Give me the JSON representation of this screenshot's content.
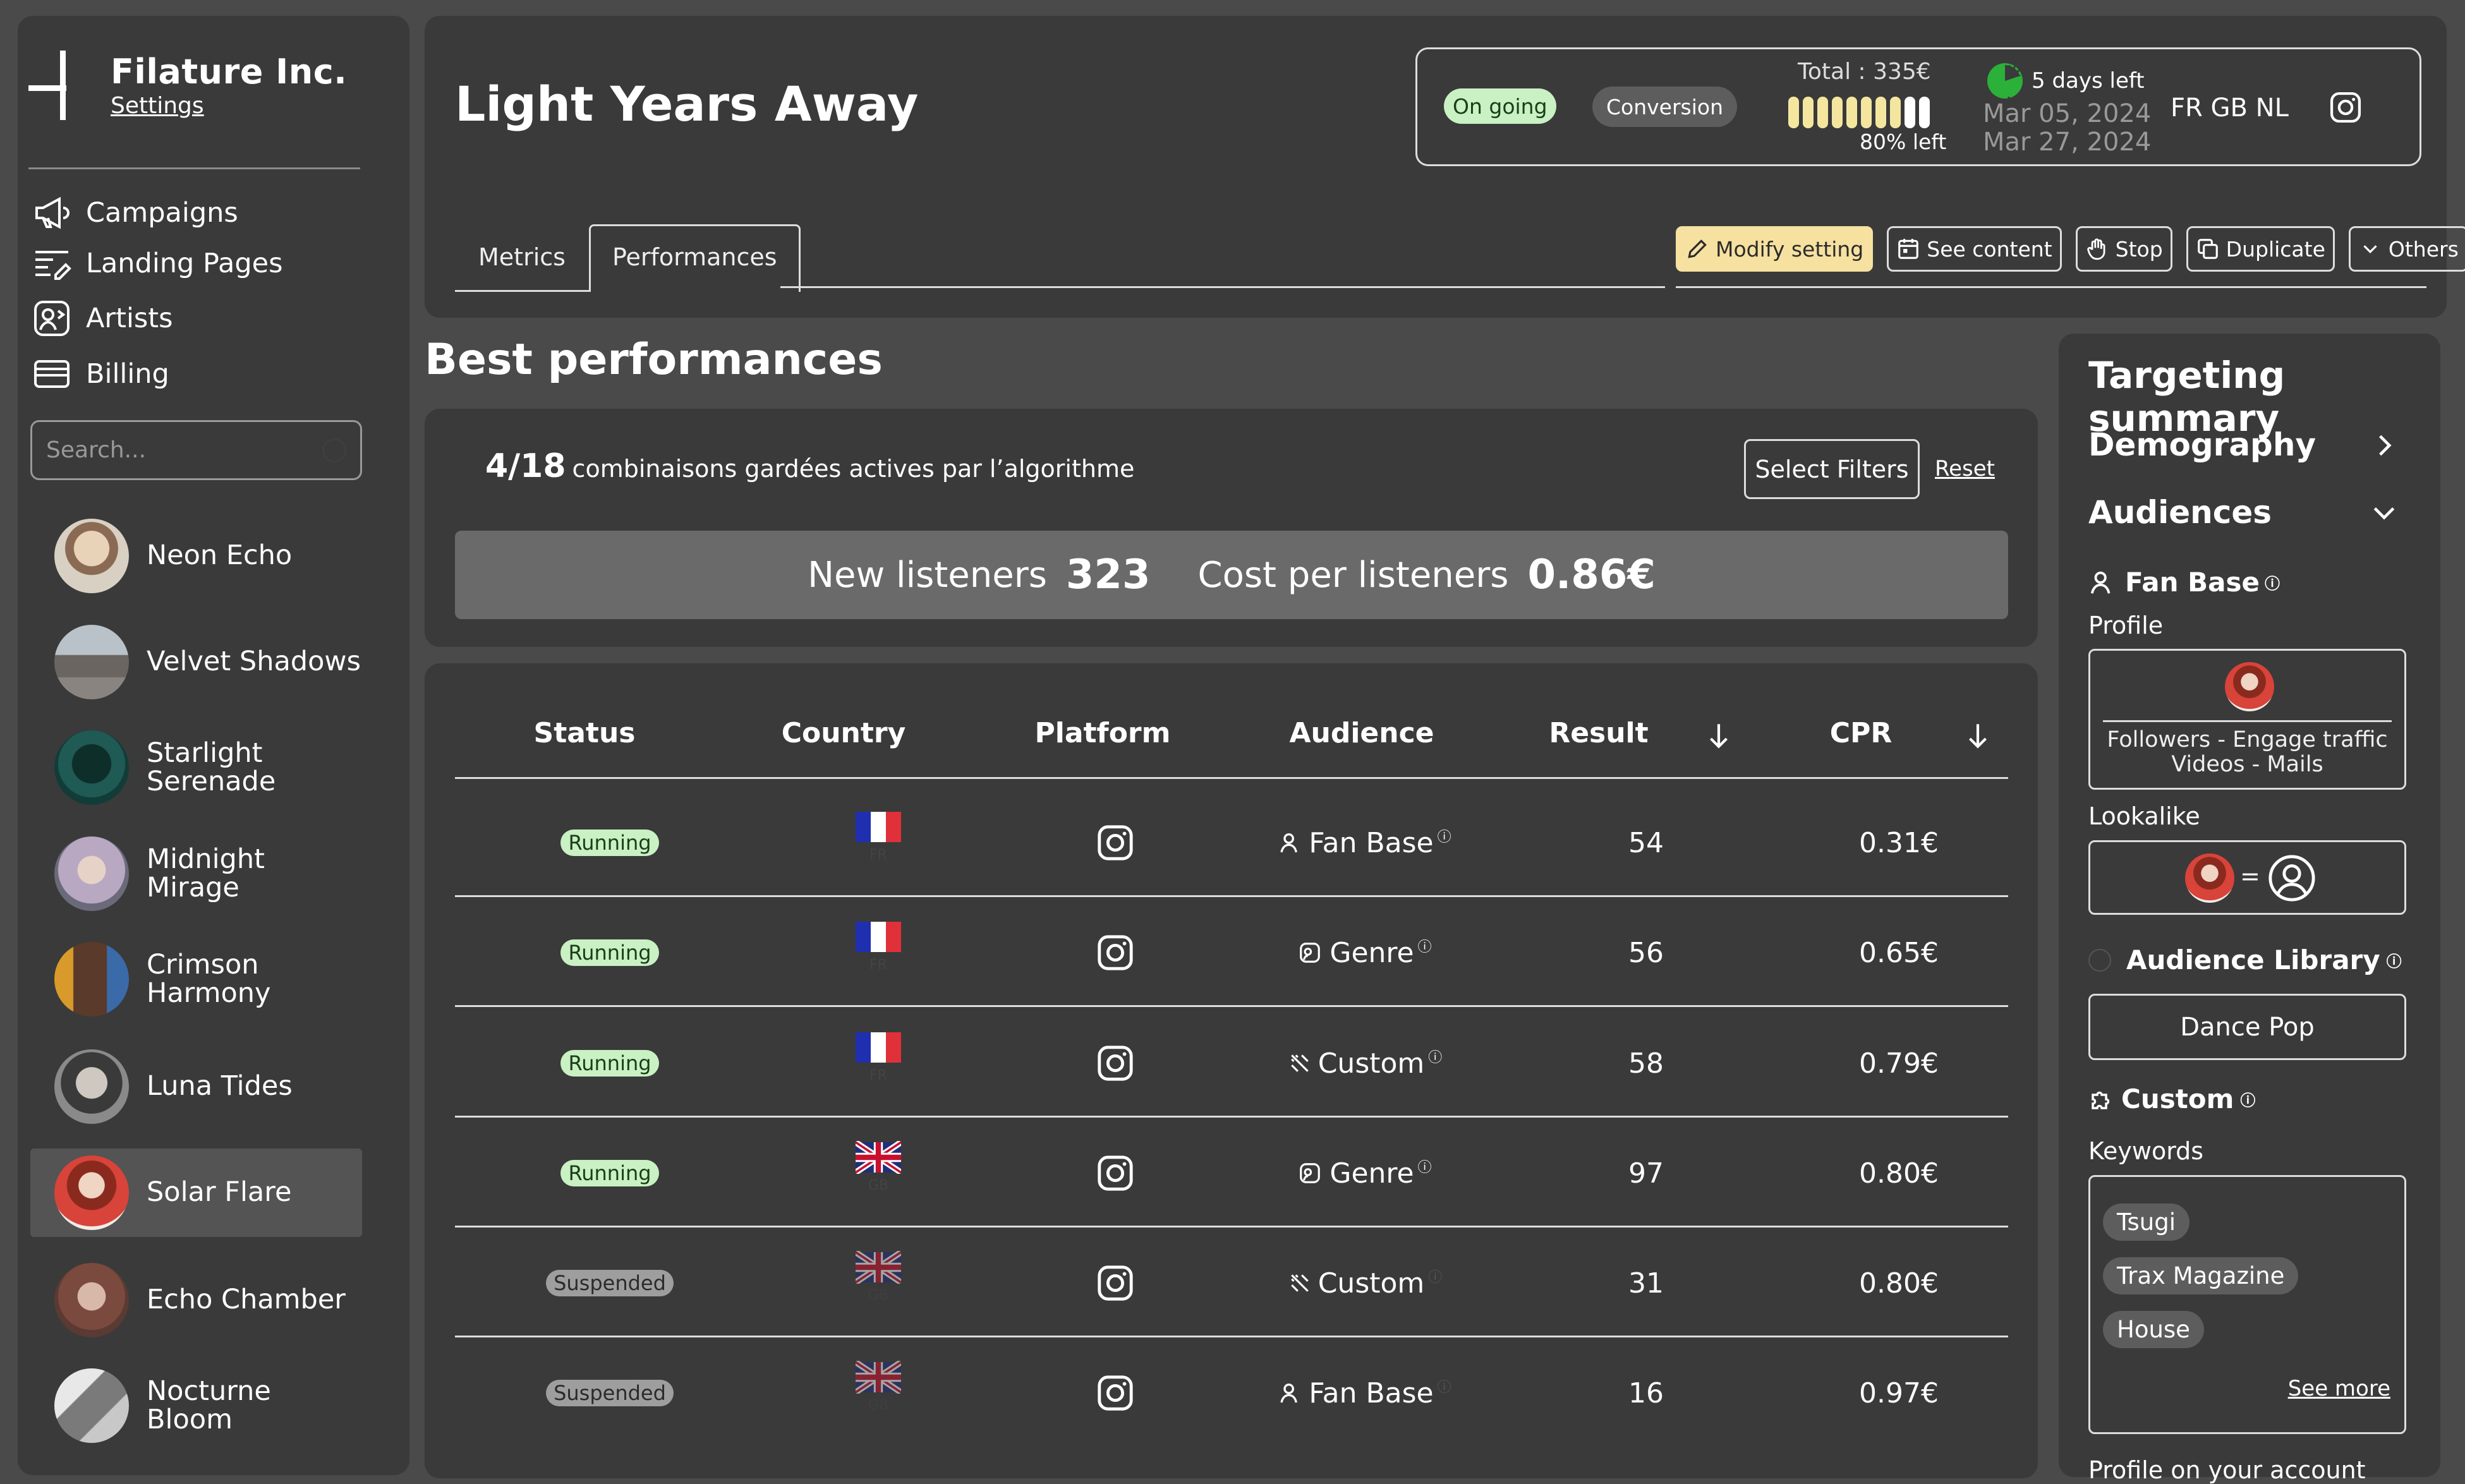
{
  "sidebar": {
    "company": "Filature Inc.",
    "settings_link": "Settings",
    "nav": [
      {
        "label": "Campaigns",
        "icon": "megaphone-icon"
      },
      {
        "label": "Landing Pages",
        "icon": "landing-pages-icon"
      },
      {
        "label": "Artists",
        "icon": "artists-icon"
      },
      {
        "label": "Billing",
        "icon": "billing-icon"
      }
    ],
    "search_placeholder": "Search...",
    "artists": [
      {
        "name": "Neon Echo",
        "color": "#c9b8a6"
      },
      {
        "name": "Velvet Shadows",
        "color": "#8e8c8a"
      },
      {
        "name": "Starlight Serenade",
        "color": "#1f5a55"
      },
      {
        "name": "Midnight Mirage",
        "color": "#b9a8c2"
      },
      {
        "name": "Crimson Harmony",
        "color": "#a05a3a"
      },
      {
        "name": "Luna Tides",
        "color": "#6a6a6a"
      },
      {
        "name": "Solar Flare",
        "color": "#d8433a",
        "active": true
      },
      {
        "name": "Echo Chamber",
        "color": "#7a4a3e"
      },
      {
        "name": "Nocturne Bloom",
        "color": "#9a9a9a"
      }
    ]
  },
  "header": {
    "title": "Light Years Away",
    "status_badge": "On going",
    "type_badge": "Conversion",
    "total": "Total : 335€",
    "budget_left": "80% left",
    "budget_left_fraction": 0.8,
    "days_left": "5 days left",
    "start_date": "Mar 05, 2024",
    "end_date": "Mar 27, 2024",
    "countries": "FR GB NL",
    "tabs": [
      "Metrics",
      "Performances"
    ],
    "active_tab": "Performances",
    "actions": [
      {
        "label": "Modify setting",
        "icon": "pencil-icon"
      },
      {
        "label": "See content",
        "icon": "calendar-icon"
      },
      {
        "label": "Stop",
        "icon": "hand-icon"
      },
      {
        "label": "Duplicate",
        "icon": "duplicate-icon"
      },
      {
        "label": "Others",
        "icon": "chevron-down-icon"
      }
    ]
  },
  "performance": {
    "section_title": "Best performances",
    "combo_count": "4/18",
    "combo_text": "combinaisons gardées actives par l’algorithme",
    "select_filters": "Select Filters",
    "reset": "Reset",
    "new_listeners_label": "New listeners",
    "new_listeners_value": "323",
    "cost_label": "Cost per listeners",
    "cost_value": "0.86€"
  },
  "table": {
    "headers": [
      "Status",
      "Country",
      "Platform",
      "Audience",
      "Result",
      "CPR"
    ],
    "rows": [
      {
        "status": "Running",
        "country": "FR",
        "audience": "Fan Base",
        "result": "54",
        "cpr": "0.31€"
      },
      {
        "status": "Running",
        "country": "FR",
        "audience": "Genre",
        "result": "56",
        "cpr": "0.65€"
      },
      {
        "status": "Running",
        "country": "FR",
        "audience": "Custom",
        "result": "58",
        "cpr": "0.79€"
      },
      {
        "status": "Running",
        "country": "GB",
        "audience": "Genre",
        "result": "97",
        "cpr": "0.80€"
      },
      {
        "status": "Suspended",
        "country": "GB",
        "audience": "Custom",
        "result": "31",
        "cpr": "0.80€"
      },
      {
        "status": "Suspended",
        "country": "GB",
        "audience": "Fan Base",
        "result": "16",
        "cpr": "0.97€"
      }
    ]
  },
  "targeting": {
    "title": "Targeting summary",
    "demography": "Demography",
    "audiences": "Audiences",
    "fan_base": "Fan Base",
    "profile_label": "Profile",
    "profile_text": "Followers - Engage traffic Videos - Mails",
    "lookalike_label": "Lookalike",
    "lookalike_eq": "=",
    "audience_library": "Audience Library",
    "library_value": "Dance Pop",
    "custom": "Custom",
    "keywords_label": "Keywords",
    "keywords": [
      "Tsugi",
      "Trax Magazine",
      "House"
    ],
    "see_more": "See more",
    "cut_text": "Profile on your account"
  }
}
